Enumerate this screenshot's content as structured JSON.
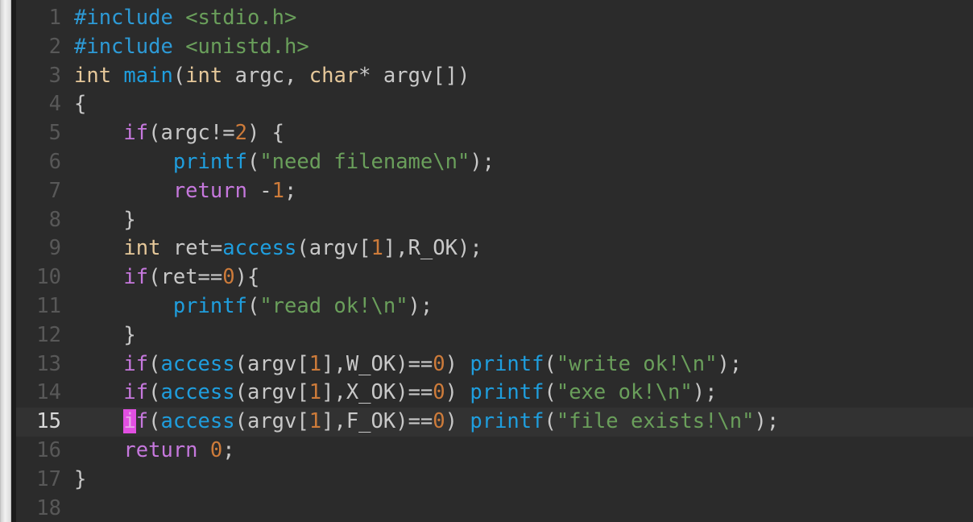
{
  "window": {
    "app": "code-editor",
    "theme": "dark",
    "background_color": "#2b2b2b",
    "current_line_bg": "#323232",
    "gutter_color": "#585858",
    "gutter_current_color": "#d8d8d8",
    "top_bar_color": "#8ede8b"
  },
  "colors": {
    "preprocessor": "#2d9ad6",
    "header": "#6a9f5b",
    "type": "#e6c89a",
    "function": "#1f9ede",
    "keyword": "#c678dd",
    "number": "#cd7b3a",
    "string": "#6a9f5b",
    "plain": "#c8c8c8",
    "cursor": "#e24fe2"
  },
  "editor": {
    "language": "c",
    "cursor_line": 15,
    "cursor_column": 5,
    "first_visible_line": 1,
    "last_visible_line": 18,
    "lines": [
      {
        "number": "1",
        "tokens": [
          {
            "t": "#include",
            "c": "k-pre"
          },
          {
            "t": " ",
            "c": "k-pl"
          },
          {
            "t": "<stdio.h>",
            "c": "k-hdr"
          }
        ]
      },
      {
        "number": "2",
        "tokens": [
          {
            "t": "#include",
            "c": "k-pre"
          },
          {
            "t": " ",
            "c": "k-pl"
          },
          {
            "t": "<unistd.h>",
            "c": "k-hdr"
          }
        ]
      },
      {
        "number": "3",
        "tokens": [
          {
            "t": "int",
            "c": "k-type"
          },
          {
            "t": " ",
            "c": "k-pl"
          },
          {
            "t": "main",
            "c": "k-fn"
          },
          {
            "t": "(",
            "c": "k-pl"
          },
          {
            "t": "int",
            "c": "k-type"
          },
          {
            "t": " argc, ",
            "c": "k-pl"
          },
          {
            "t": "char",
            "c": "k-type"
          },
          {
            "t": "* argv[])",
            "c": "k-pl"
          }
        ]
      },
      {
        "number": "4",
        "tokens": [
          {
            "t": "{",
            "c": "k-pl"
          }
        ]
      },
      {
        "number": "5",
        "tokens": [
          {
            "t": "    ",
            "c": "k-pl"
          },
          {
            "t": "if",
            "c": "k-kw"
          },
          {
            "t": "(argc!=",
            "c": "k-pl"
          },
          {
            "t": "2",
            "c": "k-num"
          },
          {
            "t": ") {",
            "c": "k-pl"
          }
        ]
      },
      {
        "number": "6",
        "tokens": [
          {
            "t": "        ",
            "c": "k-pl"
          },
          {
            "t": "printf",
            "c": "k-fn"
          },
          {
            "t": "(",
            "c": "k-pl"
          },
          {
            "t": "\"need filename\\n\"",
            "c": "k-str"
          },
          {
            "t": ");",
            "c": "k-pl"
          }
        ]
      },
      {
        "number": "7",
        "tokens": [
          {
            "t": "        ",
            "c": "k-pl"
          },
          {
            "t": "return",
            "c": "k-kw"
          },
          {
            "t": " -",
            "c": "k-pl"
          },
          {
            "t": "1",
            "c": "k-num"
          },
          {
            "t": ";",
            "c": "k-pl"
          }
        ]
      },
      {
        "number": "8",
        "tokens": [
          {
            "t": "    }",
            "c": "k-pl"
          }
        ]
      },
      {
        "number": "9",
        "tokens": [
          {
            "t": "    ",
            "c": "k-pl"
          },
          {
            "t": "int",
            "c": "k-type"
          },
          {
            "t": " ret=",
            "c": "k-pl"
          },
          {
            "t": "access",
            "c": "k-fn"
          },
          {
            "t": "(argv[",
            "c": "k-pl"
          },
          {
            "t": "1",
            "c": "k-num"
          },
          {
            "t": "],R_OK);",
            "c": "k-pl"
          }
        ]
      },
      {
        "number": "10",
        "tokens": [
          {
            "t": "    ",
            "c": "k-pl"
          },
          {
            "t": "if",
            "c": "k-kw"
          },
          {
            "t": "(ret==",
            "c": "k-pl"
          },
          {
            "t": "0",
            "c": "k-num"
          },
          {
            "t": "){",
            "c": "k-pl"
          }
        ]
      },
      {
        "number": "11",
        "tokens": [
          {
            "t": "        ",
            "c": "k-pl"
          },
          {
            "t": "printf",
            "c": "k-fn"
          },
          {
            "t": "(",
            "c": "k-pl"
          },
          {
            "t": "\"read ok!\\n\"",
            "c": "k-str"
          },
          {
            "t": ");",
            "c": "k-pl"
          }
        ]
      },
      {
        "number": "12",
        "tokens": [
          {
            "t": "    }",
            "c": "k-pl"
          }
        ]
      },
      {
        "number": "13",
        "tokens": [
          {
            "t": "    ",
            "c": "k-pl"
          },
          {
            "t": "if",
            "c": "k-kw"
          },
          {
            "t": "(",
            "c": "k-pl"
          },
          {
            "t": "access",
            "c": "k-fn"
          },
          {
            "t": "(argv[",
            "c": "k-pl"
          },
          {
            "t": "1",
            "c": "k-num"
          },
          {
            "t": "],W_OK)==",
            "c": "k-pl"
          },
          {
            "t": "0",
            "c": "k-num"
          },
          {
            "t": ") ",
            "c": "k-pl"
          },
          {
            "t": "printf",
            "c": "k-fn"
          },
          {
            "t": "(",
            "c": "k-pl"
          },
          {
            "t": "\"write ok!\\n\"",
            "c": "k-str"
          },
          {
            "t": ");",
            "c": "k-pl"
          }
        ]
      },
      {
        "number": "14",
        "tokens": [
          {
            "t": "    ",
            "c": "k-pl"
          },
          {
            "t": "if",
            "c": "k-kw"
          },
          {
            "t": "(",
            "c": "k-pl"
          },
          {
            "t": "access",
            "c": "k-fn"
          },
          {
            "t": "(argv[",
            "c": "k-pl"
          },
          {
            "t": "1",
            "c": "k-num"
          },
          {
            "t": "],X_OK)==",
            "c": "k-pl"
          },
          {
            "t": "0",
            "c": "k-num"
          },
          {
            "t": ") ",
            "c": "k-pl"
          },
          {
            "t": "printf",
            "c": "k-fn"
          },
          {
            "t": "(",
            "c": "k-pl"
          },
          {
            "t": "\"exe ok!\\n\"",
            "c": "k-str"
          },
          {
            "t": ");",
            "c": "k-pl"
          }
        ]
      },
      {
        "number": "15",
        "current": true,
        "tokens": [
          {
            "t": "    ",
            "c": "k-pl"
          },
          {
            "t": "i",
            "c": "k-kw cursor"
          },
          {
            "t": "f",
            "c": "k-kw"
          },
          {
            "t": "(",
            "c": "k-pl"
          },
          {
            "t": "access",
            "c": "k-fn"
          },
          {
            "t": "(argv[",
            "c": "k-pl"
          },
          {
            "t": "1",
            "c": "k-num"
          },
          {
            "t": "],F_OK)==",
            "c": "k-pl"
          },
          {
            "t": "0",
            "c": "k-num"
          },
          {
            "t": ") ",
            "c": "k-pl"
          },
          {
            "t": "printf",
            "c": "k-fn"
          },
          {
            "t": "(",
            "c": "k-pl"
          },
          {
            "t": "\"file exists!\\n\"",
            "c": "k-str"
          },
          {
            "t": ");",
            "c": "k-pl"
          }
        ]
      },
      {
        "number": "16",
        "tokens": [
          {
            "t": "    ",
            "c": "k-pl"
          },
          {
            "t": "return",
            "c": "k-kw"
          },
          {
            "t": " ",
            "c": "k-pl"
          },
          {
            "t": "0",
            "c": "k-num"
          },
          {
            "t": ";",
            "c": "k-pl"
          }
        ]
      },
      {
        "number": "17",
        "tokens": [
          {
            "t": "}",
            "c": "k-pl"
          }
        ]
      },
      {
        "number": "18",
        "tokens": []
      }
    ]
  }
}
